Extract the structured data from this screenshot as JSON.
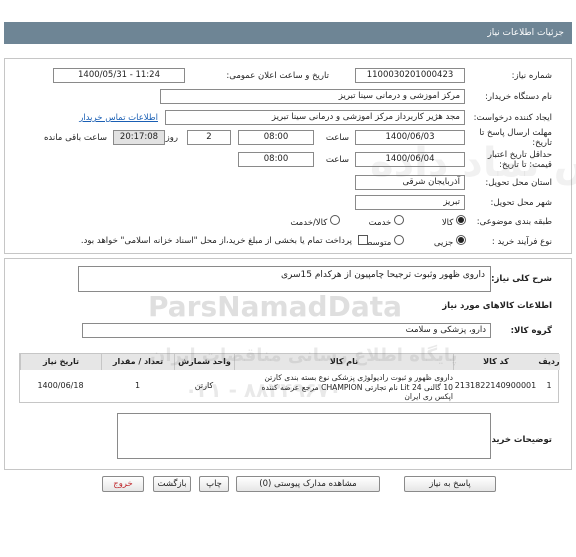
{
  "header": {
    "title": "جزئیات اطلاعات نیاز"
  },
  "fields": {
    "need_number_label": "شماره نیاز:",
    "need_number": "1100030201000423",
    "announce_label": "تاریخ و ساعت اعلان عمومی:",
    "announce_value": "1400/05/31 - 11:24",
    "buyer_org_label": "نام دستگاه خریدار:",
    "buyer_org": "مرکز اموزشی و درمانی سینا تبریز",
    "requester_label": "ایجاد کننده درخواست:",
    "requester": "مجد هژیر کاربرداز مرکز اموزشی و درمانی سینا تبریز",
    "contact_link": "اطلاعات تماس خریدار",
    "deadline_label": "مهلت ارسال پاسخ تا",
    "deadline_label2": "تاریخ:",
    "deadline_date": "1400/06/03",
    "time_label": "ساعت",
    "deadline_time": "08:00",
    "days_value": "2",
    "days_label": "روز و",
    "remaining_time": "20:17:08",
    "remaining_label": "ساعت باقی مانده",
    "min_validity_label": "حداقل تاریخ اعتبار",
    "min_validity_label2": "قیمت: تا تاریخ:",
    "validity_date": "1400/06/04",
    "validity_time": "08:00",
    "province_label": "استان محل تحویل:",
    "province": "آذربایجان شرقی",
    "city_label": "شهر محل تحویل:",
    "city": "تبریز",
    "category_label": "طبقه بندی موضوعی:",
    "category_options": [
      "کالا",
      "خدمت",
      "کالا/خدمت"
    ],
    "process_label": "نوع فرآیند خرید :",
    "process_options": [
      "جزیی",
      "متوسط"
    ],
    "payment_note": "پرداخت تمام یا بخشی از مبلغ خرید،از محل \"اسناد خزانه اسلامی\" خواهد بود."
  },
  "summary": {
    "label": "شرح کلی نیاز:",
    "value": "داروی ظهور وثبوت ترجیحا چامپیون از هرکدام 15سری"
  },
  "goods": {
    "section_title": "اطلاعات کالاهای مورد نیاز",
    "group_label": "گروه کالا:",
    "group_value": "دارو، پزشکی و سلامت",
    "columns": [
      "ردیف",
      "کد کالا",
      "نام کالا",
      "واحد شمارش",
      "تعداد / مقدار",
      "تاریخ نیاز"
    ],
    "rows": [
      {
        "index": "1",
        "code": "2131822140900001",
        "name_line1": "داروی ظهور و ثبوت رادیولوژی پزشکی نوع بسته بندی کارتن",
        "name_line2": "10 گالنی Lit 24 نام تجارتی CHAMPION مرجع عرضه کننده",
        "name_line3": "اپکس ری ایران",
        "unit": "کارتن",
        "qty": "1",
        "date": "1400/06/18"
      }
    ]
  },
  "buyer_notes": {
    "label": "توضیحات خریدار:",
    "value": ""
  },
  "buttons": {
    "reply": "پاسخ به نیاز",
    "attachments": "مشاهده مدارک پیوستی (0)",
    "print": "چاپ",
    "back": "بازگشت",
    "exit": "خروج"
  },
  "watermark": {
    "brand": "ParsNamadData",
    "fa_line1": "پایگاه اطلاع رسانی مناقصات ایران",
    "phone": "۰۲۱ - ۸۸۳۴۹۶۷۰",
    "fa_line2": "پارس نماد داده"
  },
  "colors": {
    "header_bg": "#6e8595",
    "link": "#1a5fb4",
    "exit_text": "#c0282d"
  }
}
